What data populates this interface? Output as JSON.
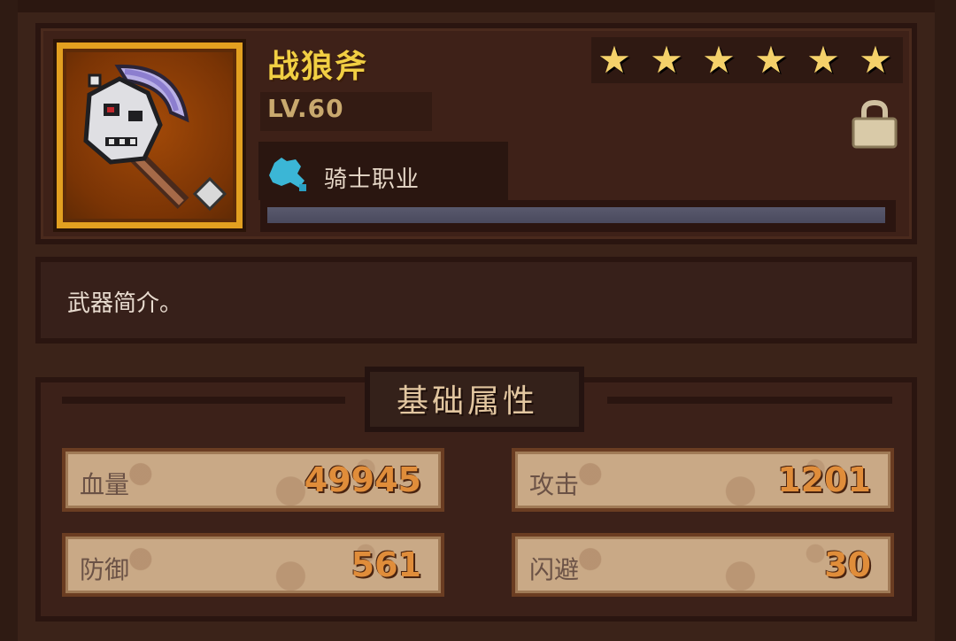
{
  "weapon": {
    "name": "战狼斧",
    "level": "LV.60",
    "stars": [
      "★",
      "★",
      "★",
      "★",
      "★",
      "★"
    ],
    "class_label": "骑士职业",
    "progress": 1.0
  },
  "description": "武器简介。",
  "attributes": {
    "title": "基础属性",
    "stats": [
      {
        "label": "血量",
        "value": "49945"
      },
      {
        "label": "攻击",
        "value": "1201"
      },
      {
        "label": "防御",
        "value": "561"
      },
      {
        "label": "闪避",
        "value": "30"
      }
    ]
  },
  "colors": {
    "name": "#f1cf43",
    "stat_value": "#e08d3a",
    "icon_frame": "#e3a020"
  },
  "icons": {
    "weapon": "skull-axe-icon",
    "class": "blue-wolf-icon",
    "lock": "lock-icon"
  }
}
